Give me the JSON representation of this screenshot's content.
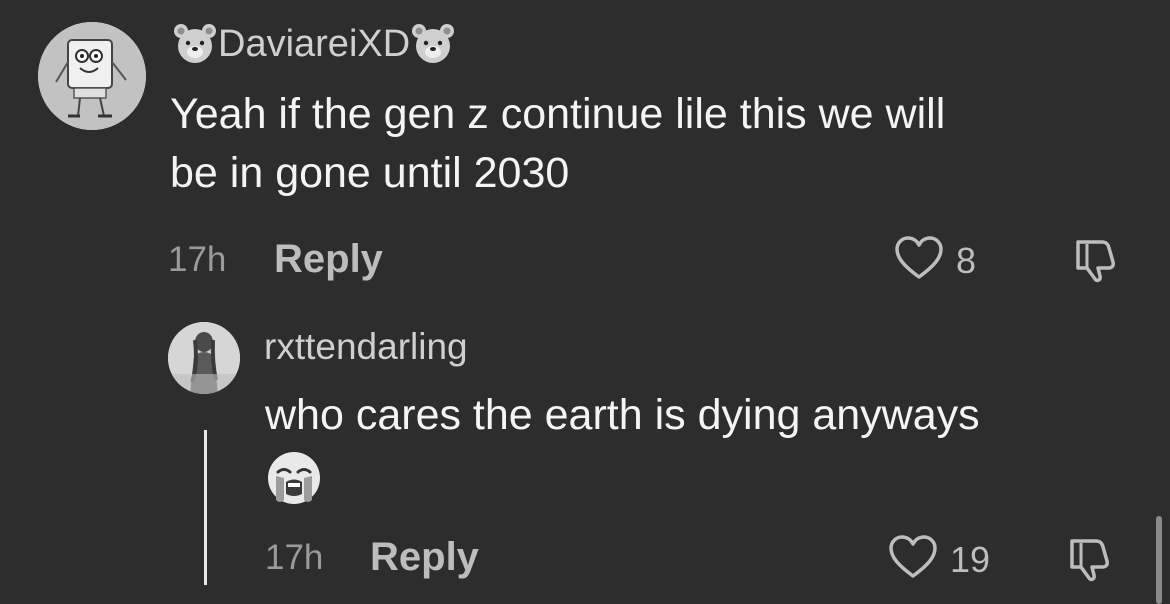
{
  "comments": [
    {
      "username": "DaviareiXD",
      "text_lines": [
        "Yeah if the gen z continue lile this we will",
        "be in gone until 2030"
      ],
      "time": "17h",
      "reply_label": "Reply",
      "like_count": "8",
      "username_icons": [
        "bear-face-icon",
        "bear-face-icon"
      ],
      "avatar": "spongebob-avatar"
    },
    {
      "username": "rxttendarling",
      "text_lines": [
        "who cares the earth is dying anyways"
      ],
      "emoji": "crying-face-emoji",
      "time": "17h",
      "reply_label": "Reply",
      "like_count": "19",
      "avatar": "person-avatar"
    }
  ],
  "colors": {
    "background": "#2d2d2d",
    "text_primary": "#f4f4f4",
    "text_secondary": "#bdbdbd",
    "text_muted": "#9a9a9a"
  }
}
